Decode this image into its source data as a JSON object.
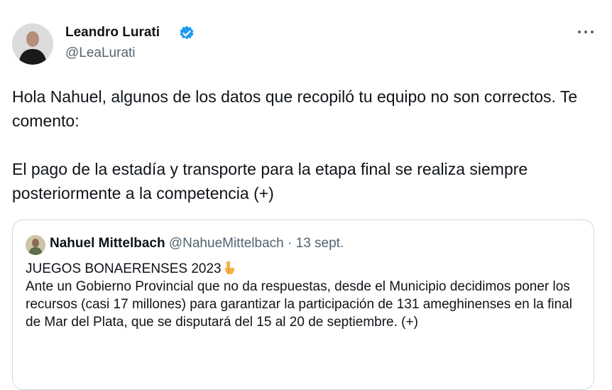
{
  "author": {
    "name": "Leandro Lurati",
    "handle": "@LeaLurati",
    "verified": true,
    "verified_color": "#1d9bf0"
  },
  "tweet": {
    "paragraphs": [
      "Hola Nahuel, algunos de los datos que recopiló tu equipo no son correctos. Te comento:",
      "El pago de la estadía y transporte para la etapa final se realiza siempre posteriormente a la competencia (+)"
    ]
  },
  "quoted": {
    "name": "Nahuel Mittelbach",
    "handle": "@NahueMittelbach",
    "separator": "·",
    "date": "13 sept.",
    "title": "JUEGOS BONAERENSES 2023",
    "title_emoji": "pointing-down-hand-icon",
    "body": "Ante un Gobierno Provincial que no da respuestas, desde el Municipio decidimos poner los recursos (casi 17 millones) para garantizar la participación de 131 ameghinenses en la final de Mar del Plata, que se disputará del 15 al 20 de septiembre. (+)"
  },
  "icons": {
    "more": "more-options-icon"
  },
  "colors": {
    "text": "#0f1419",
    "secondary": "#536471",
    "border": "#cfd9de"
  }
}
